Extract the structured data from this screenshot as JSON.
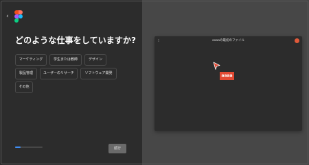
{
  "back_glyph": "‹",
  "question": "どのような仕事をしていますか?",
  "options": [
    "マーケティング",
    "学生または教師",
    "デザイン",
    "製品管理",
    "ユーザーのリサーチ",
    "ソフトウェア開発",
    "その他"
  ],
  "progress": {
    "fraction": 0.2
  },
  "next_label": "続行",
  "preview": {
    "menu_glyph": "⁝",
    "title": "aaaaの最初のファイル",
    "cursor_label": "aaaa"
  },
  "colors": {
    "accent": "#3f8ef6",
    "cursor": "#e34a33",
    "figma_red": "#f24e1e",
    "figma_orange": "#ff7262",
    "figma_purple": "#a259ff",
    "figma_blue": "#1abcfe",
    "figma_green": "#0acf83"
  },
  "icons": {
    "back": "chevron-left-icon",
    "logo": "figma-logo-icon",
    "cursor": "pointer-cursor-icon",
    "avatar": "avatar-icon"
  }
}
